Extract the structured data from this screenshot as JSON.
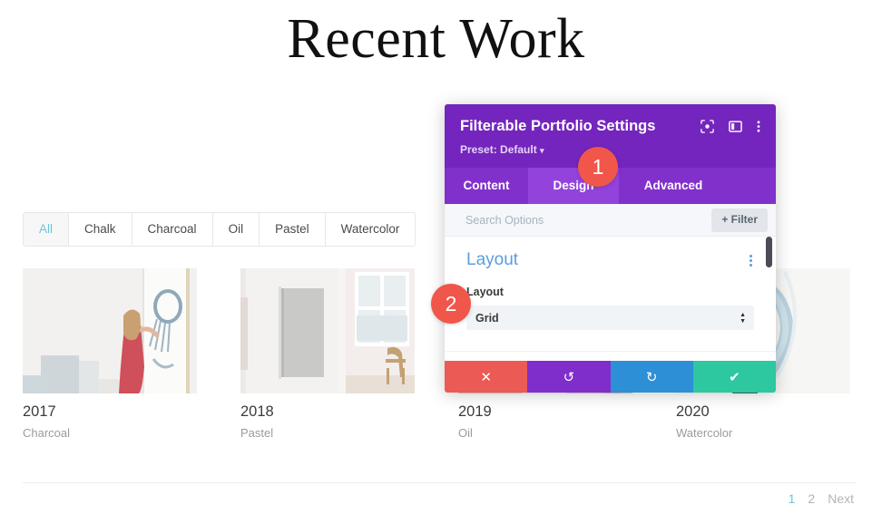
{
  "page": {
    "title": "Recent Work"
  },
  "filters": {
    "items": [
      {
        "label": "All",
        "active": true
      },
      {
        "label": "Chalk",
        "active": false
      },
      {
        "label": "Charcoal",
        "active": false
      },
      {
        "label": "Oil",
        "active": false
      },
      {
        "label": "Pastel",
        "active": false
      },
      {
        "label": "Watercolor",
        "active": false
      }
    ]
  },
  "portfolio": {
    "items": [
      {
        "title": "2017",
        "category": "Charcoal"
      },
      {
        "title": "2018",
        "category": "Pastel"
      },
      {
        "title": "2019",
        "category": "Oil"
      },
      {
        "title": "2020",
        "category": "Watercolor"
      }
    ]
  },
  "pagination": {
    "links": [
      {
        "label": "1",
        "active": true
      },
      {
        "label": "2",
        "active": false
      },
      {
        "label": "Next",
        "active": false
      }
    ]
  },
  "modal": {
    "title": "Filterable Portfolio Settings",
    "preset_label": "Preset: Default",
    "preset_caret": "▾",
    "header_icons": [
      {
        "name": "focus-target-icon"
      },
      {
        "name": "panel-layout-icon"
      },
      {
        "name": "more-options-icon"
      }
    ],
    "tabs": [
      {
        "label": "Content",
        "active": false
      },
      {
        "label": "Design",
        "active": true
      },
      {
        "label": "Advanced",
        "active": false
      }
    ],
    "search": {
      "placeholder": "Search Options",
      "filter_button": "+ Filter"
    },
    "section": {
      "title": "Layout",
      "field_label": "Layout",
      "field_value": "Grid"
    },
    "actions": [
      {
        "name": "cancel-button",
        "glyph": "✕",
        "color": "#eb5a54"
      },
      {
        "name": "undo-button",
        "glyph": "↺",
        "color": "#7f2ecb"
      },
      {
        "name": "redo-button",
        "glyph": "↻",
        "color": "#2d8fd5"
      },
      {
        "name": "save-button",
        "glyph": "✔",
        "color": "#2dc7a0"
      }
    ]
  },
  "badges": [
    {
      "label": "1"
    },
    {
      "label": "2"
    }
  ],
  "colors": {
    "accent_teal": "#6cc5d6",
    "modal_purple": "#7425bd",
    "tab_active_purple": "#9343db",
    "section_blue": "#5b9de0",
    "badge_red": "#f0564a"
  }
}
